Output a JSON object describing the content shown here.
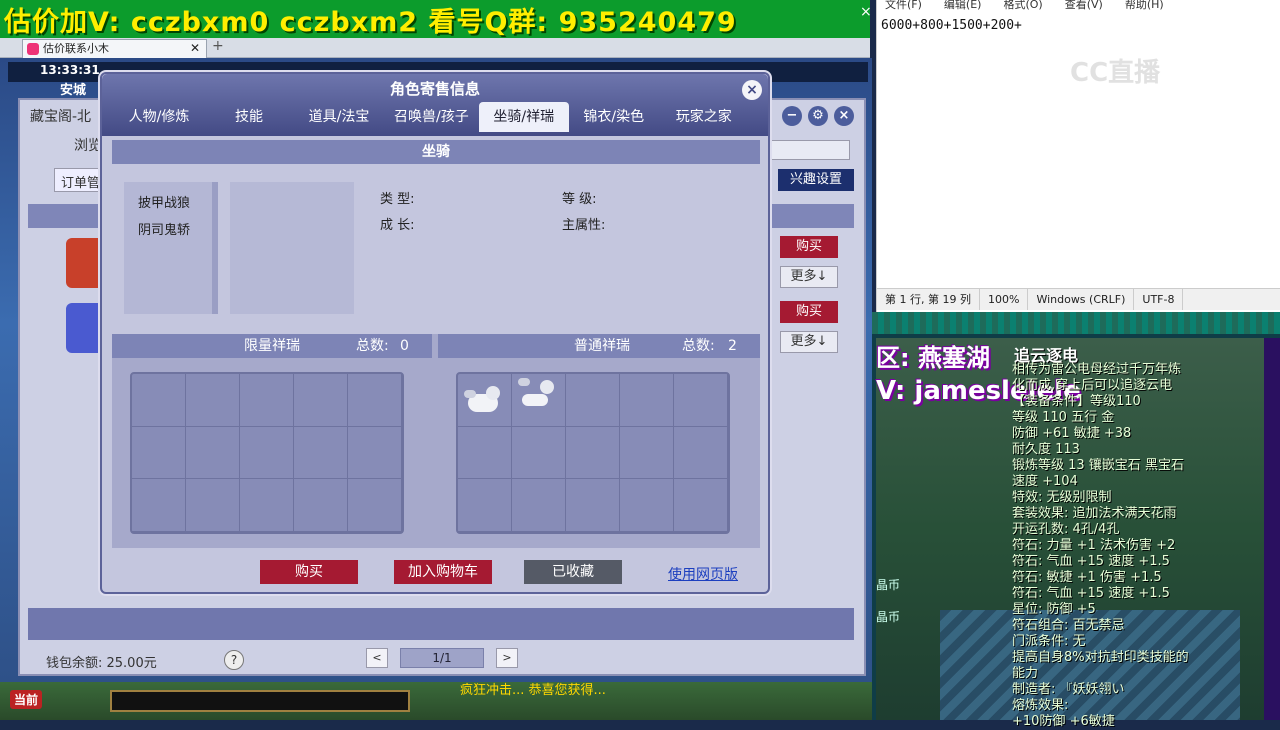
{
  "banner": {
    "text": "估价加V:  cczbxm0   cczbxm2   看号Q群: 935240479"
  },
  "browser": {
    "tab_title": "估价联系小木"
  },
  "game": {
    "clock": "13:33:31",
    "city": "安城",
    "wallet": "钱包余额: 25.00元",
    "help": "?",
    "page": "1/1",
    "now_label": "当前",
    "bottom_text": "疯狂冲击... 恭喜您获得..."
  },
  "cbg": {
    "title": "藏宝阁-北",
    "browse": "浏览",
    "orders": "订单管",
    "interest": "兴趣设置",
    "rows": [
      {
        "buy": "购买",
        "more": "更多↓",
        "avatar_color": "#c8402a"
      },
      {
        "buy": "购买",
        "more": "更多↓",
        "avatar_color": "#4a5ad0"
      }
    ]
  },
  "dialog": {
    "title": "角色寄售信息",
    "tabs": [
      {
        "label": "人物/修炼",
        "active": false
      },
      {
        "label": "技能",
        "active": false
      },
      {
        "label": "道具/法宝",
        "active": false
      },
      {
        "label": "召唤兽/孩子",
        "active": false
      },
      {
        "label": "坐骑/祥瑞",
        "active": true
      },
      {
        "label": "锦衣/染色",
        "active": false
      },
      {
        "label": "玩家之家",
        "active": false
      }
    ],
    "section_title": "坐骑",
    "mounts": [
      "披甲战狼",
      "阴司鬼轿"
    ],
    "attrs": {
      "type_label": "类 型:",
      "level_label": "等 级:",
      "growth_label": "成 长:",
      "main_attr_label": "主属性:"
    },
    "limited": {
      "title": "限量祥瑞",
      "count_label": "总数:",
      "count": "0"
    },
    "normal": {
      "title": "普通祥瑞",
      "count_label": "总数:",
      "count": "2"
    },
    "footer": {
      "buy": "购买",
      "add_cart": "加入购物车",
      "favorited": "已收藏",
      "web_version": "使用网页版"
    }
  },
  "notepad": {
    "menu": [
      "文件(F)",
      "编辑(E)",
      "格式(O)",
      "查看(V)",
      "帮助(H)"
    ],
    "text": "6000+800+1500+200+",
    "status": [
      "第 1 行, 第 19 列",
      "100%",
      "Windows (CRLF)",
      "UTF-8"
    ]
  },
  "watermark": "CC直播",
  "overlay": {
    "server": "区: 燕塞湖",
    "id": "V: jameslelele",
    "item_name": "追云逐电",
    "lines": [
      "相传为雷公电母经过千万年炼",
      "化而成,穿上后可以追逐云电",
      "【装备条件】等级110",
      "等级 110  五行 金",
      "防御 +61 敏捷 +38",
      "耐久度 113",
      "锻炼等级 13  镶嵌宝石 黑宝石",
      "速度 +104",
      "特效: 无级别限制",
      "套装效果: 追加法术满天花雨",
      "开运孔数: 4孔/4孔",
      "符石: 力量 +1 法术伤害 +2",
      "符石: 气血 +15 速度 +1.5",
      "符石: 敏捷 +1 伤害 +1.5",
      "符石: 气血 +15 速度 +1.5",
      "星位: 防御 +5",
      "符石组合: 百无禁忌",
      "门派条件: 无",
      "提高自身8%对抗封印类技能的",
      "能力",
      "制造者: 『妖妖翎い",
      "熔炼效果:",
      "+10防御 +6敏捷"
    ],
    "coin1": "晶币",
    "coin2": "晶币"
  }
}
